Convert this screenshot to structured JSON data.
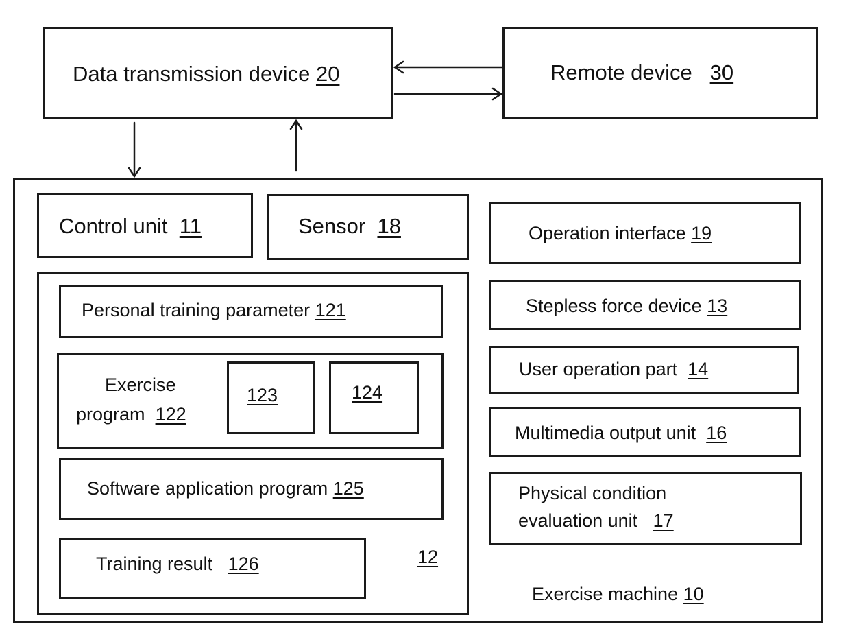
{
  "diagram": {
    "data_transmission_device": {
      "label": "Data transmission device",
      "ref": "20"
    },
    "remote_device": {
      "label": "Remote device",
      "ref": "30"
    },
    "exercise_machine": {
      "label": "Exercise machine",
      "ref": "10"
    },
    "control_unit": {
      "label": "Control unit",
      "ref": "11"
    },
    "sensor": {
      "label": "Sensor",
      "ref": "18"
    },
    "storage_unit": {
      "ref": "12"
    },
    "personal_training_parameter": {
      "label": "Personal training parameter",
      "ref": "121"
    },
    "exercise_program": {
      "label_line1": "Exercise",
      "label_line2": "program",
      "ref": "122"
    },
    "sub_program_a": {
      "ref": "123"
    },
    "sub_program_b": {
      "ref": "124"
    },
    "software_application_program": {
      "label": "Software application program",
      "ref": "125"
    },
    "training_result": {
      "label": "Training result",
      "ref": "126"
    },
    "operation_interface": {
      "label": "Operation interface",
      "ref": "19"
    },
    "stepless_force_device": {
      "label": "Stepless force device",
      "ref": "13"
    },
    "user_operation_part": {
      "label": "User operation part",
      "ref": "14"
    },
    "multimedia_output_unit": {
      "label": "Multimedia output unit",
      "ref": "16"
    },
    "physical_condition_evaluation_unit": {
      "label_line1": "Physical condition",
      "label_line2": "evaluation unit",
      "ref": "17"
    }
  },
  "connections": [
    {
      "from": "remote_device",
      "to": "data_transmission_device"
    },
    {
      "from": "data_transmission_device",
      "to": "remote_device"
    },
    {
      "from": "data_transmission_device",
      "to": "exercise_machine"
    },
    {
      "from": "exercise_machine",
      "to": "data_transmission_device"
    }
  ]
}
